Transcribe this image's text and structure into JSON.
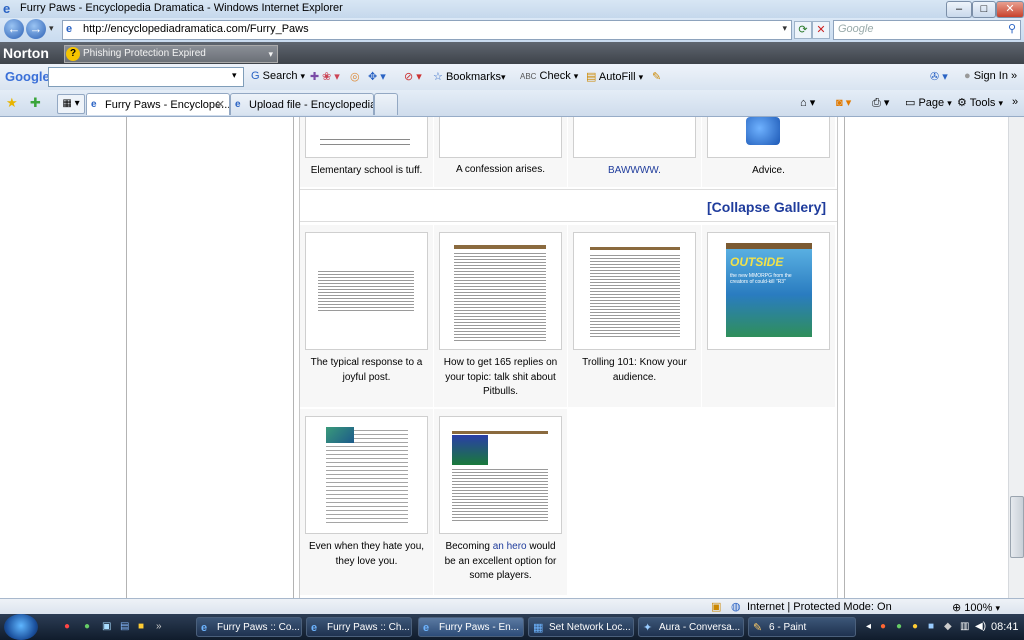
{
  "window": {
    "title": "Furry Paws - Encyclopedia Dramatica - Windows Internet Explorer",
    "minimize": "–",
    "maximize": "□",
    "close": "✕"
  },
  "address": {
    "url": "http://encyclopediadramatica.com/Furry_Paws",
    "search_placeholder": "Google"
  },
  "norton": {
    "logo": "Norton",
    "warning": "Phishing Protection Expired"
  },
  "google_toolbar": {
    "logo": "Google",
    "search_label": "Search",
    "bookmarks_label": "Bookmarks",
    "check_label": "Check",
    "autofill_label": "AutoFill",
    "signin_label": "Sign In"
  },
  "tabs": [
    {
      "label": "Furry Paws - Encyclope..."
    },
    {
      "label": "Upload file - Encyclopedia ..."
    }
  ],
  "command_bar": {
    "page_label": "Page",
    "tools_label": "Tools"
  },
  "gallery": {
    "collapse_label": "[Collapse Gallery]",
    "top_captions": [
      "Elementary school is tuff.",
      "A confession arises.",
      "BAWWWW.",
      "Advice."
    ],
    "row1": [
      {
        "line1": "The typical response to a",
        "line2": "joyful post.",
        "line3": ""
      },
      {
        "line1": "How to get 165 replies on",
        "line2": "your topic: talk shit about",
        "line3": "Pitbulls."
      },
      {
        "line1": "Trolling 101: Know your",
        "line2": "audience.",
        "line3": ""
      }
    ],
    "row2": [
      {
        "line1": "Even when they hate you,",
        "line2": "they love you.",
        "line3": ""
      },
      {
        "line1_pre": "Becoming ",
        "line1_link": "an hero",
        "line1_post": " would",
        "line2": "be an excellent option for",
        "line3": "some players."
      }
    ],
    "outside_magazine": {
      "title": "OUTSIDE",
      "subtitle": "the new MMORPG from the creators of could-kill \"R3\""
    }
  },
  "status": {
    "zone": "Internet | Protected Mode: On",
    "zoom": "100%"
  },
  "taskbar": {
    "items": [
      {
        "label": "Furry Paws :: Co..."
      },
      {
        "label": "Furry Paws :: Ch..."
      },
      {
        "label": "Furry Paws - En..."
      },
      {
        "label": "Set Network Loc..."
      },
      {
        "label": "Aura - Conversa..."
      },
      {
        "label": "6 - Paint"
      }
    ],
    "clock": "08:41"
  },
  "colors": {
    "link": "#1f3c9c",
    "collapse": "#1f3c9c",
    "norton_bg": "#4a5058",
    "taskbar_bg": "#1a2940"
  }
}
